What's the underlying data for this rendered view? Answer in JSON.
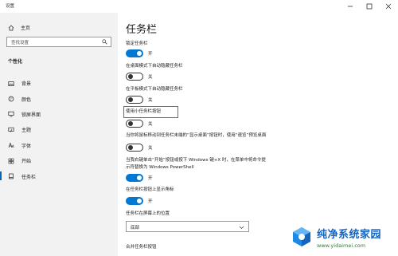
{
  "window": {
    "title": "设置",
    "controls": [
      "minimize-icon",
      "maximize-icon",
      "close-icon"
    ]
  },
  "sidebar": {
    "home_label": "主页",
    "search_placeholder": "查找设置",
    "section_title": "个性化",
    "items": [
      {
        "label": "背景",
        "icon": "picture-icon"
      },
      {
        "label": "颜色",
        "icon": "palette-icon"
      },
      {
        "label": "锁屏界面",
        "icon": "monitor-icon"
      },
      {
        "label": "主题",
        "icon": "brush-icon"
      },
      {
        "label": "字体",
        "icon": "font-icon"
      },
      {
        "label": "开始",
        "icon": "start-icon"
      },
      {
        "label": "任务栏",
        "icon": "taskbar-icon",
        "active": true
      }
    ]
  },
  "main": {
    "title": "任务栏",
    "settings": [
      {
        "label": "锁定任务栏",
        "state": "开",
        "on": true
      },
      {
        "label": "在桌面模式下自动隐藏任务栏",
        "state": "关",
        "on": false
      },
      {
        "label": "在平板模式下自动隐藏任务栏",
        "state": "关",
        "on": false
      },
      {
        "label": "使用小任务栏按钮",
        "state": "关",
        "on": false
      },
      {
        "label": "当你将鼠标移动到任务栏末端的“显示桌面”按钮时，使用“速览”预览桌面",
        "state": "关",
        "on": false
      },
      {
        "label_line1": "当我右键单击“开始”按钮或按下 Windows 键+X 时，在菜单中将命令提",
        "label_line2": "示符替换为 Windows PowerShell",
        "state": "开",
        "on": true
      },
      {
        "label": "在任务栏按钮上显示角标",
        "state": "开",
        "on": true
      }
    ],
    "position_label": "任务栏在屏幕上的位置",
    "position_value": "底部",
    "combine_label": "合并任务栏按钮"
  },
  "watermark": {
    "name": "纯净系统家园",
    "url": "www.yidaimei.com"
  },
  "colors": {
    "accent": "#0078d4",
    "sidebar_bg": "#f2f2f2",
    "highlight": "#e53935"
  }
}
